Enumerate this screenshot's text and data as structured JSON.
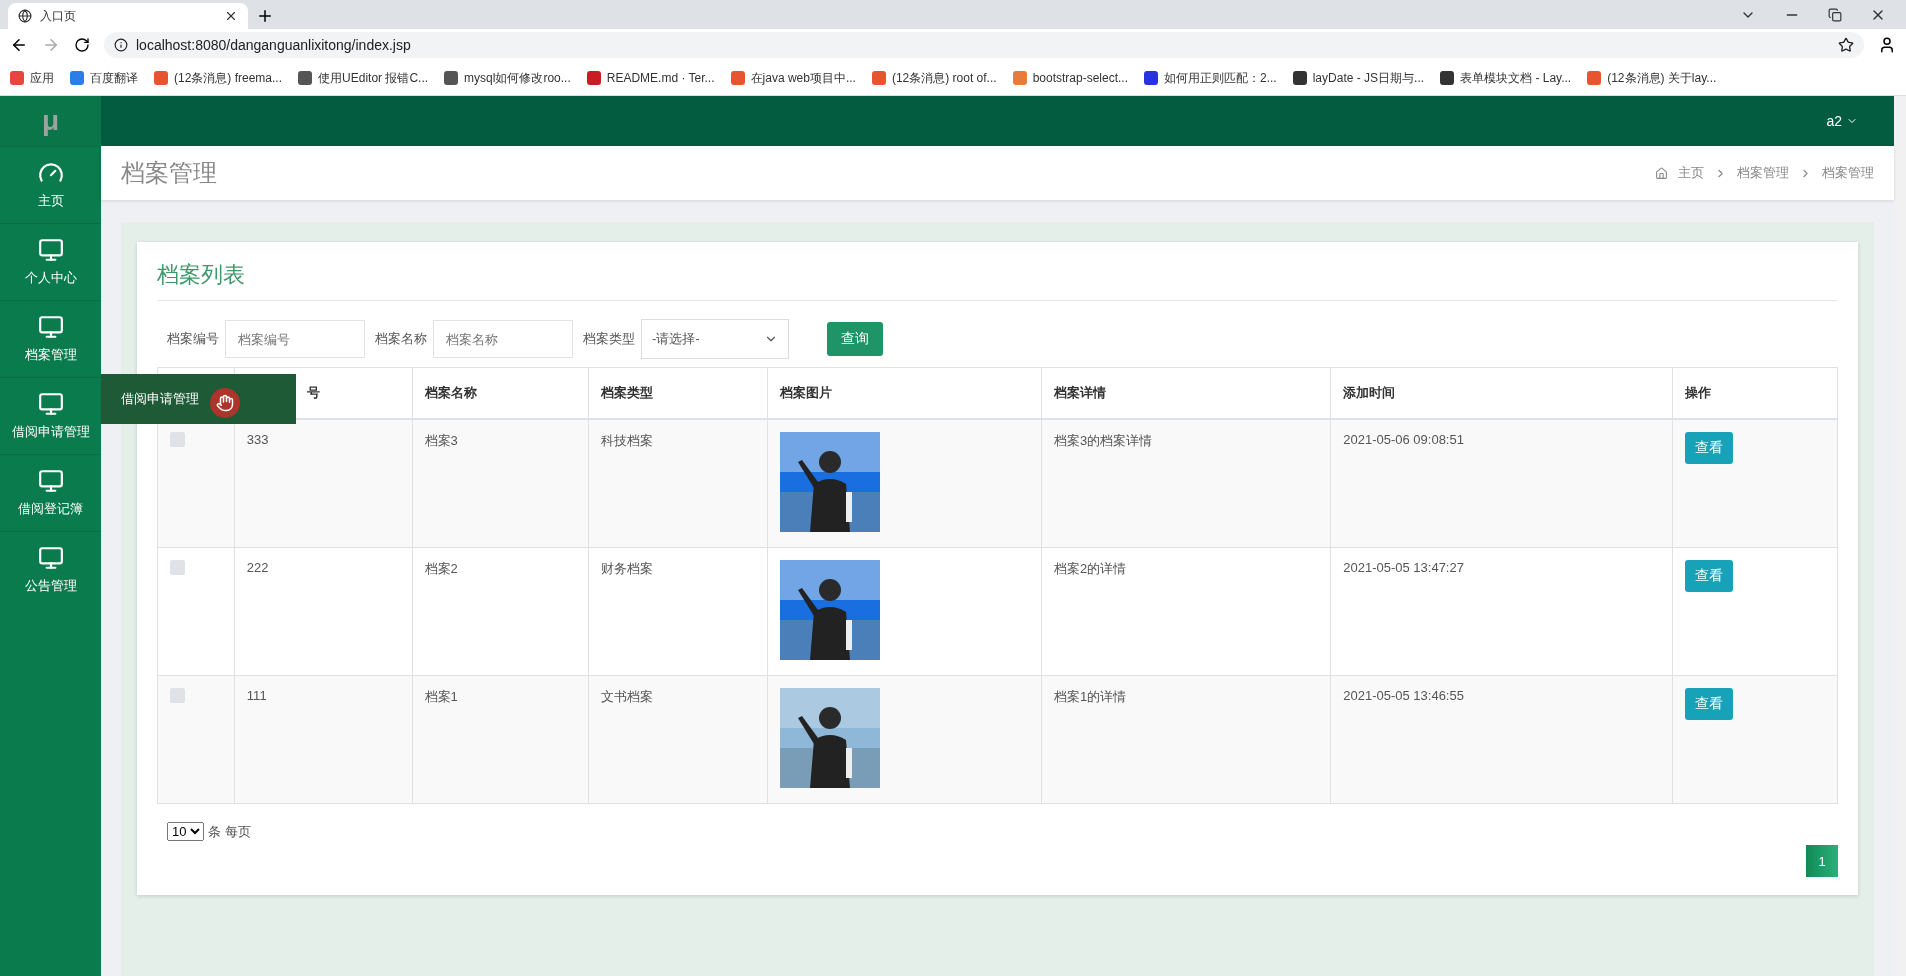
{
  "browser": {
    "tab_title": "入口页",
    "url": "localhost:8080/danganguanlixitong/index.jsp",
    "bookmarks": [
      {
        "label": "应用",
        "color": "#e8453c"
      },
      {
        "label": "百度翻译",
        "color": "#2b7de9"
      },
      {
        "label": "(12条消息) freema...",
        "color": "#e8542f"
      },
      {
        "label": "使用UEditor 报错C...",
        "color": "#555555"
      },
      {
        "label": "mysql如何修改roo...",
        "color": "#555555"
      },
      {
        "label": "README.md · Ter...",
        "color": "#c71d23"
      },
      {
        "label": "在java web项目中...",
        "color": "#e8542f"
      },
      {
        "label": "(12条消息) root of...",
        "color": "#e8542f"
      },
      {
        "label": "bootstrap-select...",
        "color": "#e87a3c"
      },
      {
        "label": "如何用正则匹配：2...",
        "color": "#2932e1"
      },
      {
        "label": "layDate - JS日期与...",
        "color": "#333333"
      },
      {
        "label": "表单模块文档 - Lay...",
        "color": "#333333"
      },
      {
        "label": "(12条消息) 关于lay...",
        "color": "#e8542f"
      }
    ]
  },
  "logo": "μ",
  "user": "a2",
  "sidebar": {
    "items": [
      {
        "label": "主页",
        "kind": "gauge"
      },
      {
        "label": "个人中心",
        "kind": "monitor"
      },
      {
        "label": "档案管理",
        "kind": "monitor"
      },
      {
        "label": "借阅申请管理",
        "kind": "monitor"
      },
      {
        "label": "借阅登记簿",
        "kind": "monitor"
      },
      {
        "label": "公告管理",
        "kind": "monitor"
      }
    ],
    "flyout": "借阅申请管理"
  },
  "page_title": "档案管理",
  "breadcrumb": [
    "主页",
    "档案管理",
    "档案管理"
  ],
  "card_title": "档案列表",
  "filters": [
    {
      "label": "档案编号",
      "kind": "text",
      "placeholder": "档案编号"
    },
    {
      "label": "档案名称",
      "kind": "text",
      "placeholder": "档案名称"
    },
    {
      "label": "档案类型",
      "kind": "select",
      "value": "-请选择-"
    }
  ],
  "search_button": "查询",
  "table": {
    "columns": [
      "",
      "号",
      "档案名称",
      "档案类型",
      "档案图片",
      "档案详情",
      "添加时间",
      "操作"
    ],
    "rows": [
      {
        "checked": false,
        "cells": [
          "",
          "333",
          "档案3",
          "科技档案",
          "",
          "档案3的档案详情",
          "2021-05-06 09:08:51"
        ],
        "action": "查看"
      },
      {
        "checked": false,
        "cells": [
          "",
          "222",
          "档案2",
          "财务档案",
          "",
          "档案2的详情",
          "2021-05-05 13:47:27"
        ],
        "action": "查看"
      },
      {
        "checked": false,
        "cells": [
          "",
          "111",
          "档案1",
          "文书档案",
          "",
          "档案1的详情",
          "2021-05-05 13:46:55"
        ],
        "action": "查看"
      }
    ]
  },
  "page_size": {
    "value": "10",
    "label": "条 每页"
  },
  "pagination": [
    {
      "label": "1",
      "selected": true
    }
  ]
}
